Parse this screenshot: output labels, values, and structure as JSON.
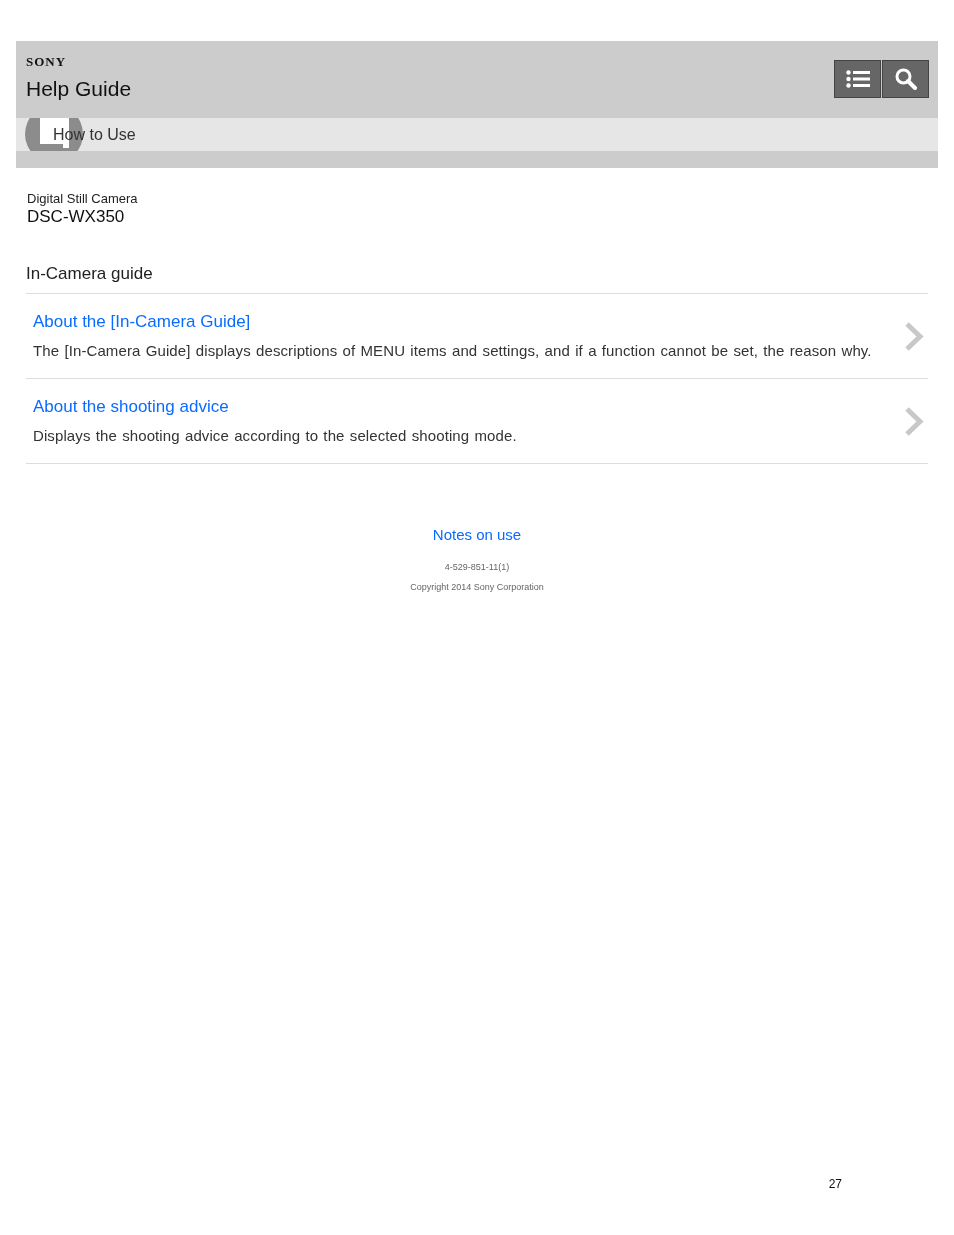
{
  "header": {
    "brand": "SONY",
    "title": "Help Guide",
    "buttons": [
      {
        "kind": "list"
      },
      {
        "kind": "search"
      }
    ]
  },
  "breadcrumb": {
    "label": "How to Use"
  },
  "product": {
    "category": "Digital Still Camera",
    "model": "DSC-WX350"
  },
  "section": {
    "title": "In-Camera guide",
    "items": [
      {
        "title": "About the [In-Camera Guide]",
        "description": "The [In-Camera Guide] displays descriptions of MENU items and settings, and if a function cannot be set, the reason why."
      },
      {
        "title": "About the shooting advice",
        "description": "Displays the shooting advice according to the selected shooting mode."
      }
    ]
  },
  "footer": {
    "link": "Notes on use",
    "code": "4-529-851-11(1)",
    "copyright": "Copyright 2014 Sony Corporation"
  },
  "page_number": "27"
}
